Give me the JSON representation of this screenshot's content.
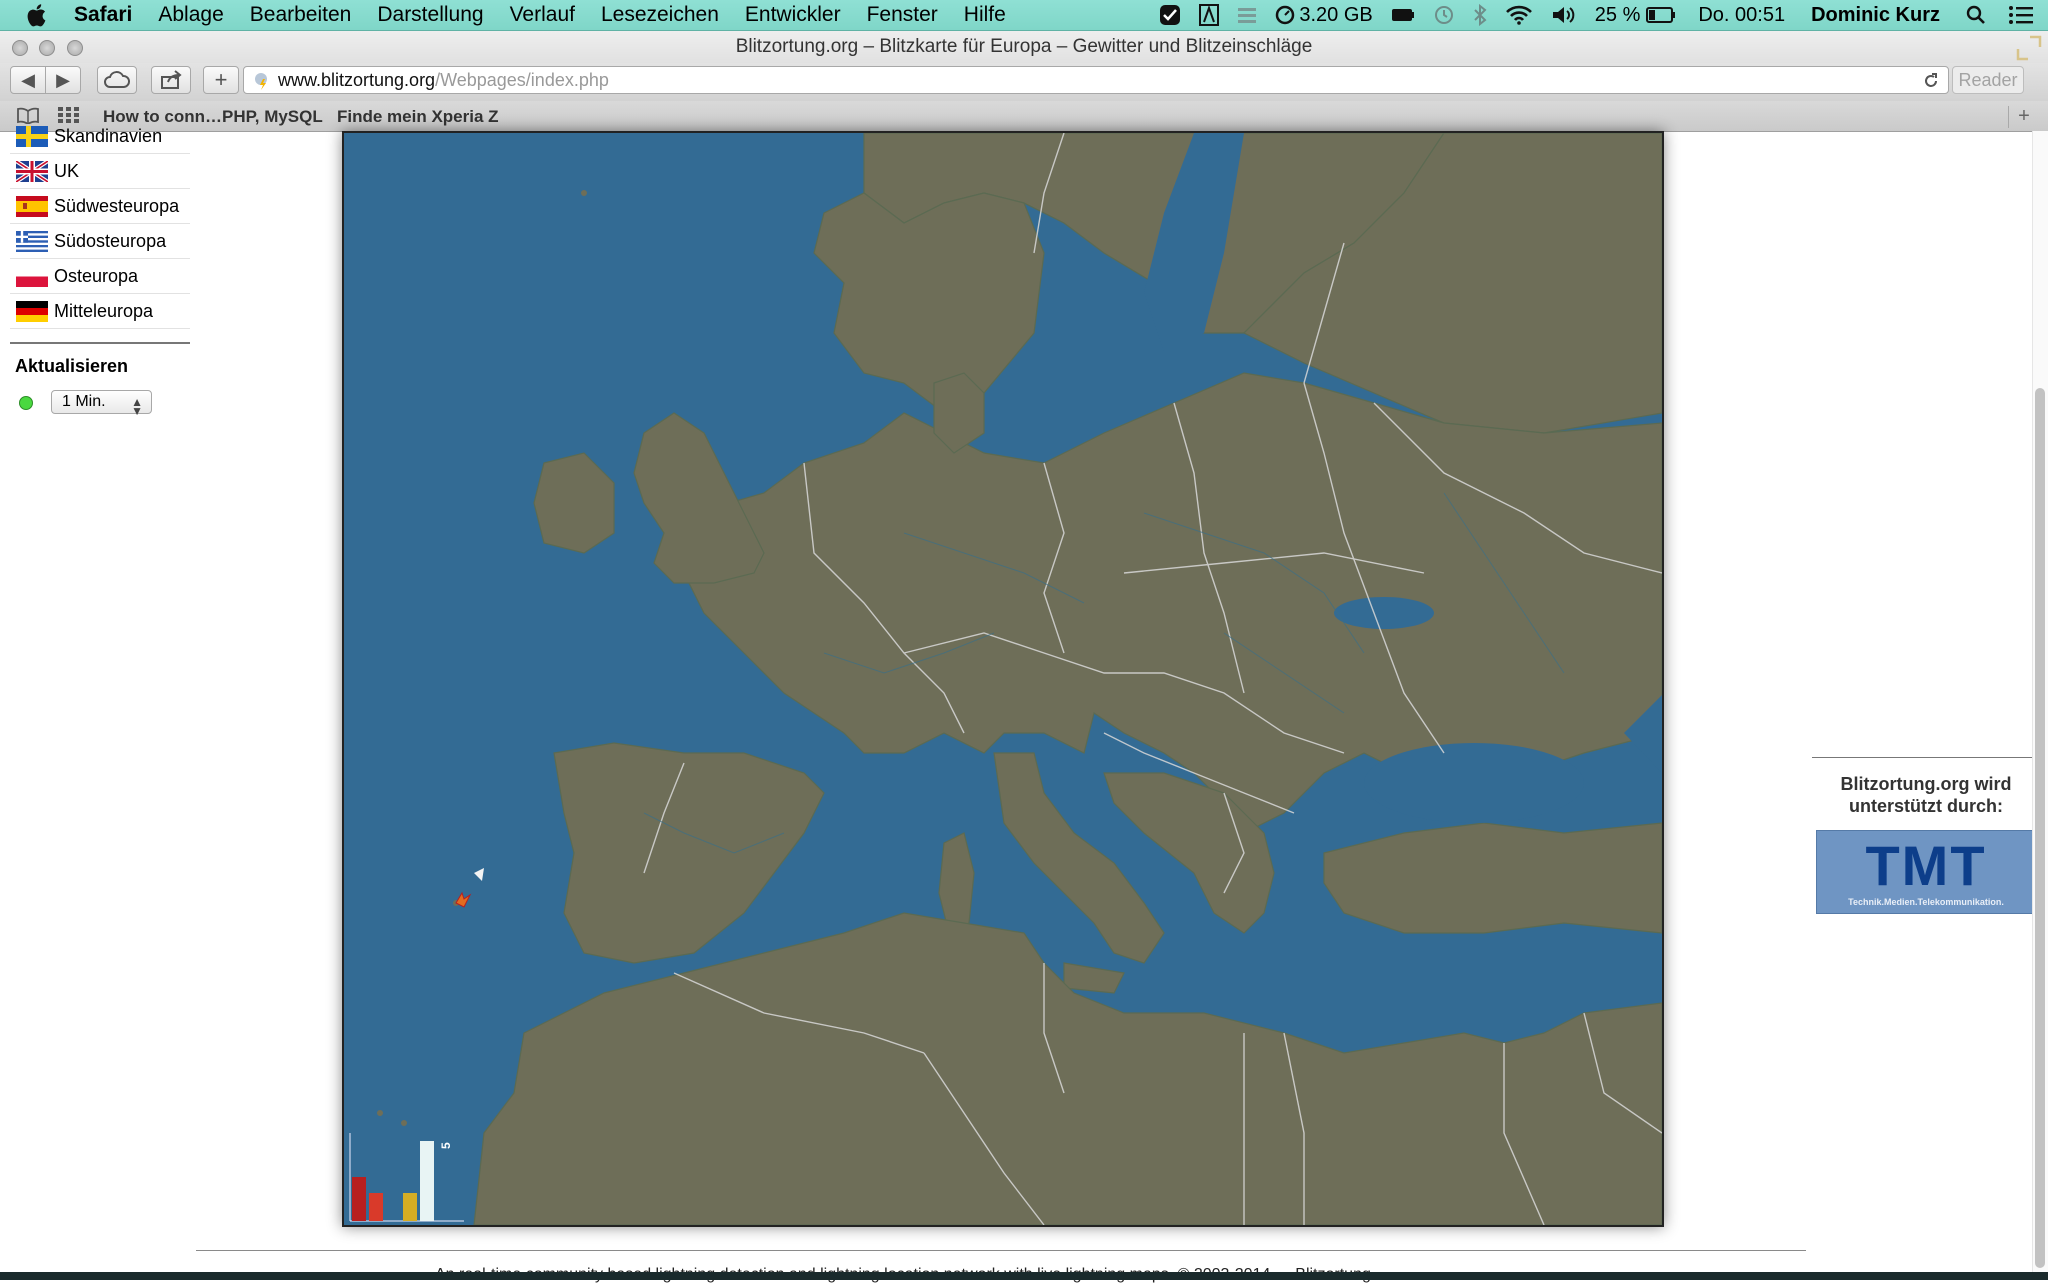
{
  "menubar": {
    "items": [
      "Safari",
      "Ablage",
      "Bearbeiten",
      "Darstellung",
      "Verlauf",
      "Lesezeichen",
      "Entwickler",
      "Fenster",
      "Hilfe"
    ],
    "memory": "3.20 GB",
    "battery": "25 %",
    "clock": "Do. 00:51",
    "user": "Dominic Kurz",
    "icons": [
      "apple-icon",
      "checkmark-shield-icon",
      "adobe-icon",
      "menu-extra-icon",
      "memory-gauge-icon",
      "battery-full-icon",
      "time-machine-icon",
      "bluetooth-icon",
      "wifi-icon",
      "volume-icon",
      "battery-icon",
      "spotlight-icon",
      "notification-list-icon"
    ]
  },
  "window": {
    "title": "Blitzortung.org – Blitzkarte für Europa – Gewitter und Blitzeinschläge"
  },
  "toolbar": {
    "url_host": "www.blitzortung.org",
    "url_path": "/Webpages/index.php",
    "reader": "Reader"
  },
  "bookmarks": {
    "items": [
      "How to conn…PHP, MySQL",
      "Finde mein Xperia Z"
    ]
  },
  "sidebar": {
    "regions": [
      {
        "label": "Skandinavien",
        "flag": "se"
      },
      {
        "label": "UK",
        "flag": "gb"
      },
      {
        "label": "Südwesteuropa",
        "flag": "es"
      },
      {
        "label": "Südosteuropa",
        "flag": "gr"
      },
      {
        "label": "Osteuropa",
        "flag": "pl"
      },
      {
        "label": "Mitteleuropa",
        "flag": "de"
      }
    ],
    "update_title": "Aktualisieren",
    "interval": "1 Min."
  },
  "map": {
    "colors": {
      "sea": "#336b94",
      "land": "#6e6e58",
      "border": "#d8d8d8",
      "river": "#3c6f86"
    },
    "histogram_max_label": "5",
    "histogram_values": [
      0.55,
      0.35,
      0.0,
      0.35,
      1.0
    ],
    "histogram_colors": [
      "#b81f1f",
      "#d93a2a",
      "#e36c1f",
      "#d6ad24",
      "#e8f4f4"
    ]
  },
  "sponsor": {
    "text_line1": "Blitzortung.org wird",
    "text_line2": "unterstützt durch:",
    "logo": "TMT",
    "logo_sub": "Technik.Medien.Telekommunikation."
  },
  "footer": {
    "text": "An real-time community based lightning detection and lightning location network with live lightning maps. © 2003-2014 — Blitzortung"
  }
}
